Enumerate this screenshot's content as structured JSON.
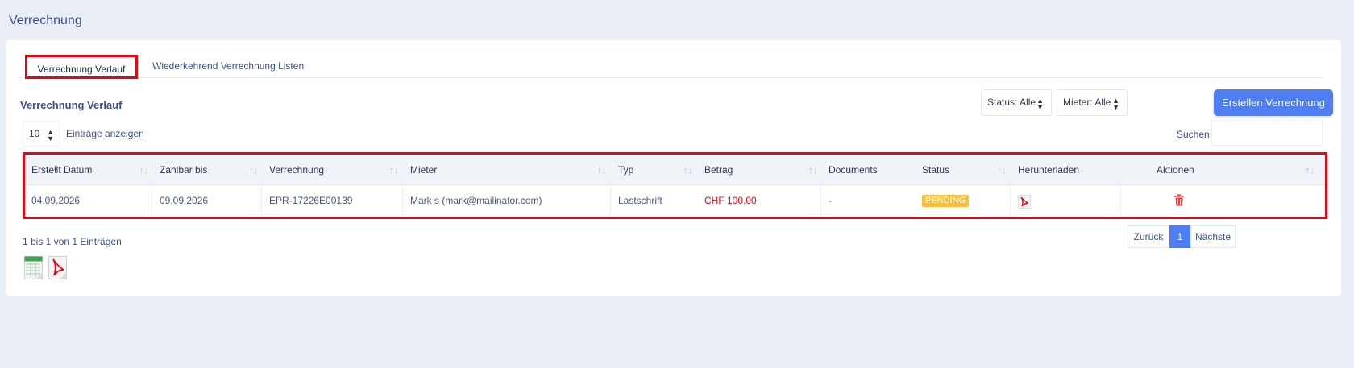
{
  "page": {
    "title": "Verrechnung"
  },
  "tabs": [
    {
      "label": "Verrechnung Verlauf",
      "active": true
    },
    {
      "label": "Wiederkehrend Verrechnung Listen",
      "active": false
    }
  ],
  "section": {
    "title": "Verrechnung Verlauf"
  },
  "filters": {
    "status": "Status: Alle",
    "mieter": "Mieter: Alle",
    "create_label": "Erstellen Verrechnung"
  },
  "length": {
    "value": "10",
    "label": "Einträge anzeigen"
  },
  "search": {
    "label": "Suchen",
    "value": ""
  },
  "table": {
    "headers": [
      "Erstellt Datum",
      "Zahlbar bis",
      "Verrechnung",
      "Mieter",
      "Typ",
      "Betrag",
      "Documents",
      "Status",
      "Herunterladen",
      "Aktionen"
    ],
    "rows": [
      {
        "erstellt": "04.09.2026",
        "zahlbar": "09.09.2026",
        "verrechnung": "EPR-17226E00139",
        "mieter": "Mark s (mark@mailinator.com)",
        "typ": "Lastschrift",
        "betrag": "CHF 100.00",
        "documents": "-",
        "status": "PENDING"
      }
    ]
  },
  "footer": {
    "info": "1 bis 1 von 1 Einträgen",
    "prev": "Zurück",
    "page": "1",
    "next": "Nächste"
  },
  "colors": {
    "accent": "#4f7df2",
    "highlight": "#e30613",
    "badge": "#f3c13a",
    "amount": "#e30613"
  },
  "icons": {
    "sort": "sort-arrows-icon",
    "download": "pdf-icon",
    "delete": "trash-icon",
    "export_excel": "excel-icon",
    "export_pdf": "pdf-icon"
  }
}
